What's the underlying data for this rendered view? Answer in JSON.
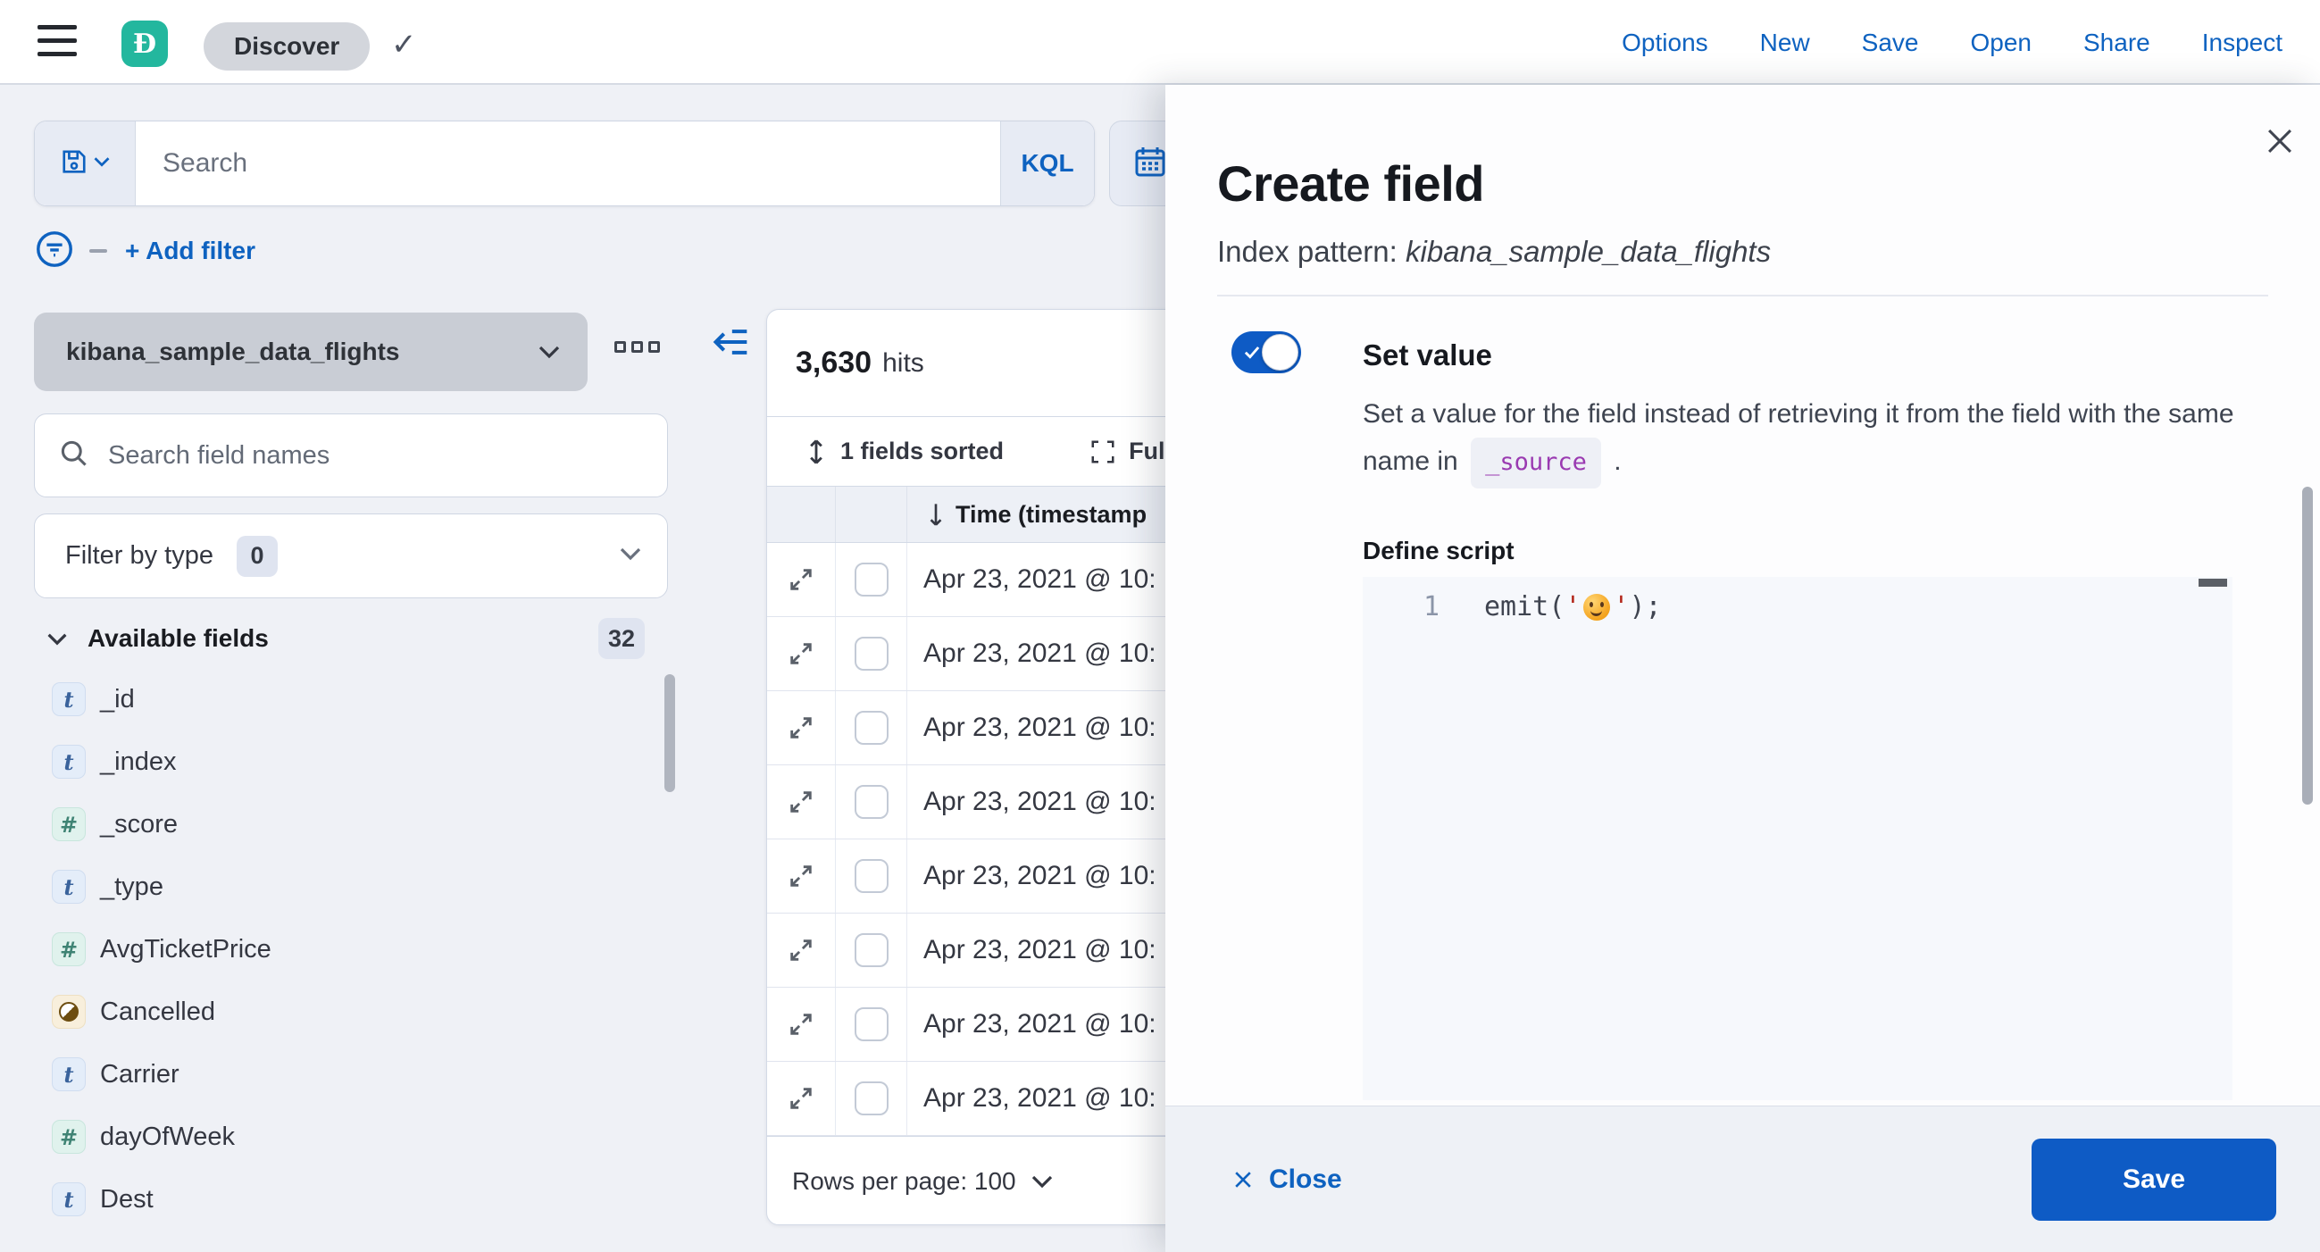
{
  "header": {
    "logo_letter": "Đ",
    "breadcrumb": "Discover",
    "nav": {
      "options": "Options",
      "new": "New",
      "save": "Save",
      "open": "Open",
      "share": "Share",
      "inspect": "Inspect"
    }
  },
  "query_bar": {
    "search_placeholder": "Search",
    "language": "KQL",
    "add_filter": "+ Add filter"
  },
  "sidebar": {
    "index_pattern": "kibana_sample_data_flights",
    "field_search_placeholder": "Search field names",
    "filter_by_type": "Filter by type",
    "filter_count": "0",
    "available_fields": "Available fields",
    "available_count": "32",
    "fields": [
      {
        "type": "t",
        "name": "_id"
      },
      {
        "type": "t",
        "name": "_index"
      },
      {
        "type": "#",
        "name": "_score"
      },
      {
        "type": "t",
        "name": "_type"
      },
      {
        "type": "#",
        "name": "AvgTicketPrice"
      },
      {
        "type": "boolean",
        "name": "Cancelled"
      },
      {
        "type": "t",
        "name": "Carrier"
      },
      {
        "type": "#",
        "name": "dayOfWeek"
      },
      {
        "type": "t",
        "name": "Dest"
      }
    ]
  },
  "results": {
    "hits_value": "3,630",
    "hits_label": "hits",
    "sorted": "1 fields sorted",
    "fullscreen": "Full",
    "time_column": "Time (timestamp",
    "rows": [
      "Apr 23, 2021 @ 10:",
      "Apr 23, 2021 @ 10:",
      "Apr 23, 2021 @ 10:",
      "Apr 23, 2021 @ 10:",
      "Apr 23, 2021 @ 10:",
      "Apr 23, 2021 @ 10:",
      "Apr 23, 2021 @ 10:",
      "Apr 23, 2021 @ 10:"
    ],
    "rows_per_page": "Rows per page: 100"
  },
  "flyout": {
    "title": "Create field",
    "index_pattern_label": "Index pattern: ",
    "index_pattern_value": "kibana_sample_data_flights",
    "set_value_label": "Set value",
    "set_value_desc_1": "Set a value for the field instead of retrieving it from the field with the same name in",
    "source_code": "_source",
    "set_value_desc_2": ".",
    "define_script": "Define script",
    "editor": {
      "line_number": "1",
      "code_fn": "emit(",
      "quote": "'",
      "emoji": "🙂",
      "code_end": ");"
    },
    "close": "Close",
    "save": "Save"
  },
  "colors": {
    "primary": "#0e5bc5",
    "link": "#0e62c0",
    "teal": "#23b79e"
  }
}
